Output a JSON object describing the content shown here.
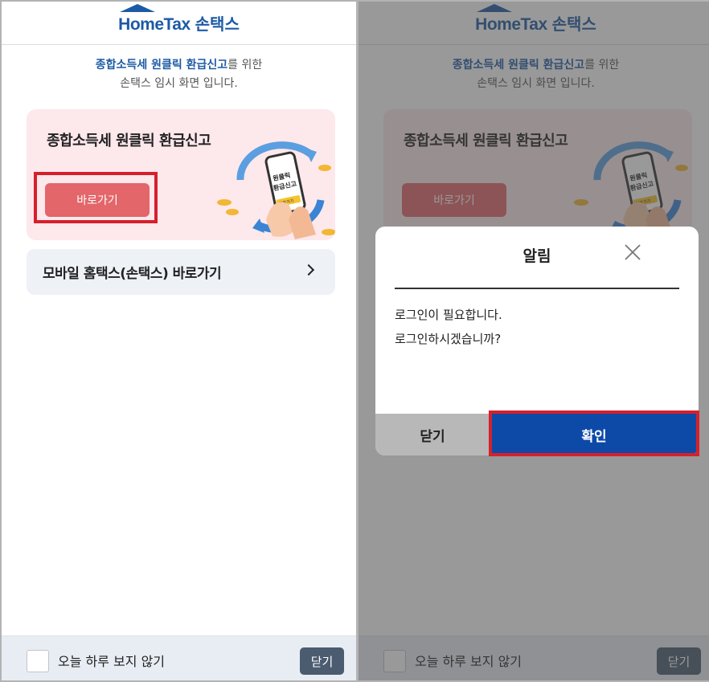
{
  "header": {
    "logo_en": "HomeTax",
    "logo_ko": "손택스"
  },
  "intro": {
    "highlight": "종합소득세 원클릭 환급신고",
    "suffix": "를 위한",
    "line2": "손택스 임시 화면 입니다."
  },
  "card": {
    "title": "종합소득세 원클릭 환급신고",
    "button_label": "바로가기",
    "phone_text_line1": "원클릭",
    "phone_text_line2": "환급신고",
    "phone_button": "바로가기"
  },
  "mobile_link": {
    "label": "모바일 홈택스(손택스) 바로가기",
    "icon": "chevron-right-icon"
  },
  "footer": {
    "checkbox_label": "오늘 하루 보지 않기",
    "close_label": "닫기"
  },
  "dialog": {
    "title": "알림",
    "message_line1": "로그인이 필요합니다.",
    "message_line2": "로그인하시겠습니까?",
    "cancel_label": "닫기",
    "confirm_label": "확인",
    "close_icon": "close-icon"
  },
  "colors": {
    "brand": "#1d5aa5",
    "primary_button": "#0d4aa8",
    "card_button": "#e3666a",
    "highlight_box": "#d6202c"
  }
}
